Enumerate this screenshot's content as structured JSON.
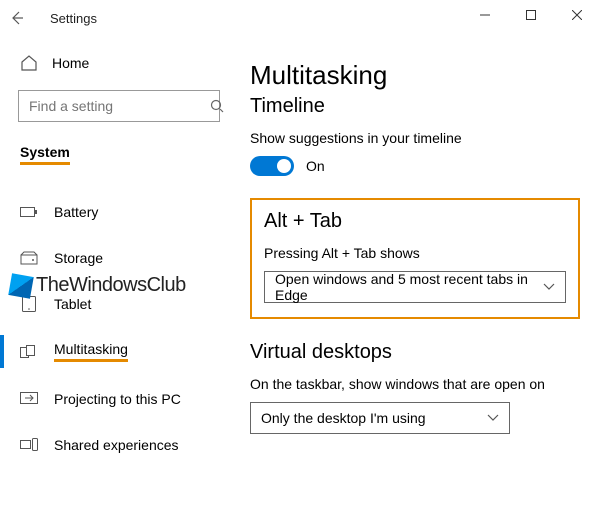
{
  "titlebar": {
    "title": "Settings"
  },
  "sidebar": {
    "home": "Home",
    "search_placeholder": "Find a setting",
    "system_label": "System",
    "items": [
      {
        "label": "Battery"
      },
      {
        "label": "Storage"
      },
      {
        "label": "Tablet"
      },
      {
        "label": "Multitasking"
      },
      {
        "label": "Projecting to this PC"
      },
      {
        "label": "Shared experiences"
      }
    ]
  },
  "main": {
    "heading": "Multitasking",
    "timeline": {
      "title": "Timeline",
      "sub": "Show suggestions in your timeline",
      "toggle_state": "On"
    },
    "alttab": {
      "title": "Alt + Tab",
      "sub": "Pressing Alt + Tab shows",
      "selected": "Open windows and 5 most recent tabs in Edge"
    },
    "virtual": {
      "title": "Virtual desktops",
      "sub": "On the taskbar, show windows that are open on",
      "selected": "Only the desktop I'm using"
    }
  },
  "watermark": "TheWindowsClub"
}
